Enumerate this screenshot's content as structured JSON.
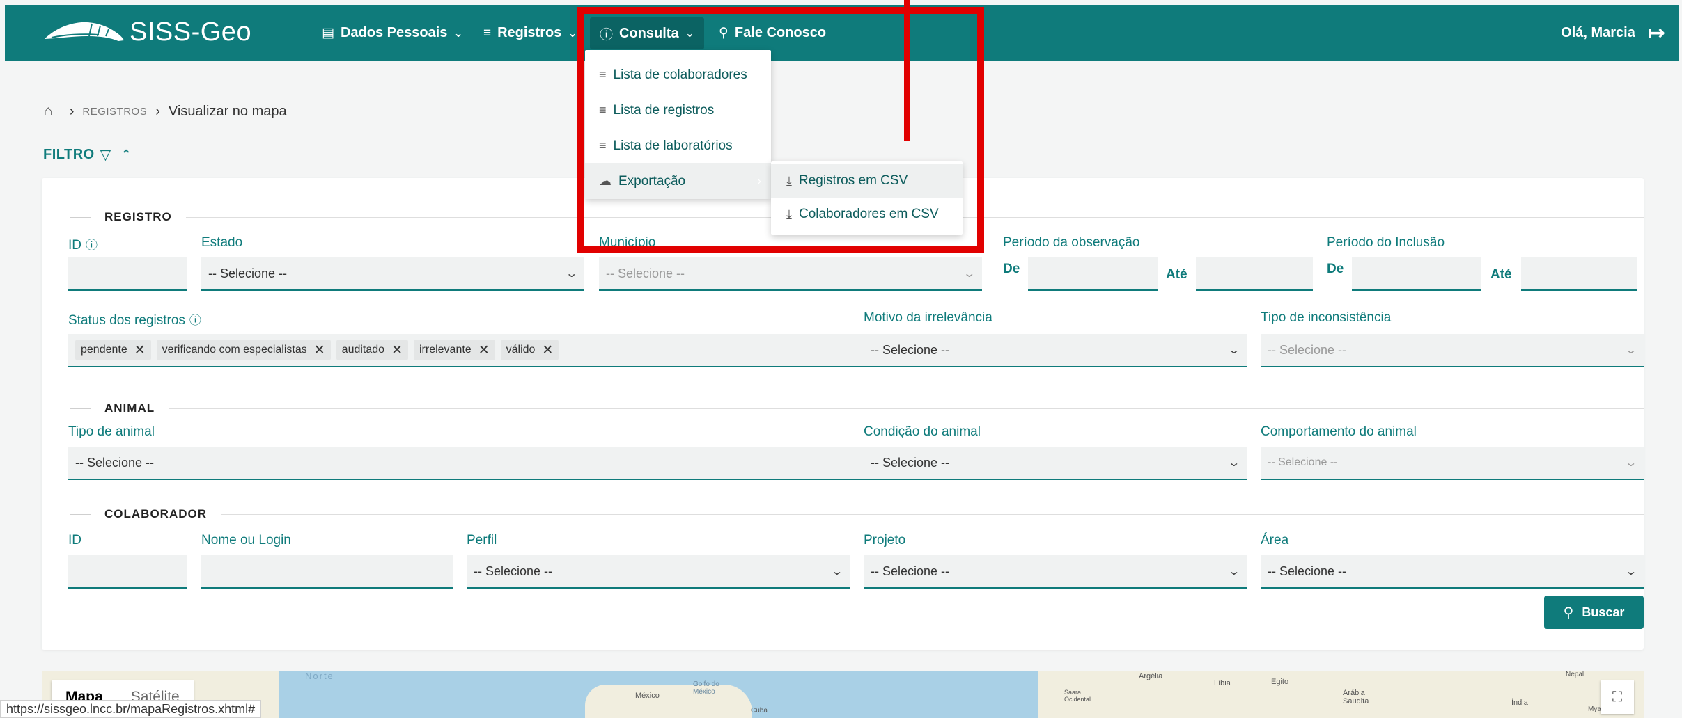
{
  "app": {
    "name": "SISS-Geo"
  },
  "nav": {
    "dados_pessoais": "Dados Pessoais",
    "registros": "Registros",
    "consulta": "Consulta",
    "fale_conosco": "Fale Conosco",
    "user_greeting": "Olá, Marcia"
  },
  "consulta_menu": {
    "items": [
      {
        "label": "Lista de colaboradores"
      },
      {
        "label": "Lista de registros"
      },
      {
        "label": "Lista de laboratórios"
      },
      {
        "label": "Exportação"
      }
    ],
    "export_submenu": [
      {
        "label": "Registros em CSV"
      },
      {
        "label": "Colaboradores em CSV"
      }
    ]
  },
  "breadcrumb": {
    "section": "REGISTROS",
    "current": "Visualizar no mapa"
  },
  "filter": {
    "title": "FILTRO",
    "registro": {
      "section_title": "REGISTRO",
      "id_label": "ID",
      "estado_label": "Estado",
      "estado_value": "-- Selecione --",
      "municipio_label": "Município",
      "municipio_value": "-- Selecione --",
      "periodo_observacao_label": "Período da observação",
      "periodo_inclusao_label": "Período do Inclusão",
      "de_label": "De",
      "ate_label": "Até",
      "status_label": "Status dos registros",
      "status_chips": [
        "pendente",
        "verificando com especialistas",
        "auditado",
        "irrelevante",
        "válido"
      ],
      "motivo_label": "Motivo da irrelevância",
      "motivo_value": "-- Selecione --",
      "inconsistencia_label": "Tipo de inconsistência",
      "inconsistencia_value": "-- Selecione --"
    },
    "animal": {
      "section_title": "ANIMAL",
      "tipo_label": "Tipo de animal",
      "tipo_value": "-- Selecione --",
      "condicao_label": "Condição do animal",
      "condicao_value": "-- Selecione --",
      "comportamento_label": "Comportamento do animal",
      "comportamento_value": "-- Selecione --"
    },
    "colaborador": {
      "section_title": "COLABORADOR",
      "id_label": "ID",
      "nome_label": "Nome ou Login",
      "perfil_label": "Perfil",
      "perfil_value": "-- Selecione --",
      "projeto_label": "Projeto",
      "projeto_value": "-- Selecione --",
      "area_label": "Área",
      "area_value": "-- Selecione --"
    },
    "search_button": "Buscar"
  },
  "map": {
    "tab_map": "Mapa",
    "tab_satellite": "Satélite",
    "labels": {
      "norte": "Norte",
      "golfo": "Golfo do México",
      "mexico": "México",
      "cuba": "Cuba",
      "argelia": "Argélia",
      "libia": "Líbia",
      "egito": "Egito",
      "saara": "Saara Ocidental",
      "arabia": "Arábia Saudita",
      "nepal": "Nepal",
      "india": "Índia",
      "myanmar": "Myanmar"
    }
  },
  "status_bar_url": "https://sissgeo.lncc.br/mapaRegistros.xhtml#",
  "colors": {
    "primary": "#0f7b7b",
    "annotation": "#e10000"
  }
}
